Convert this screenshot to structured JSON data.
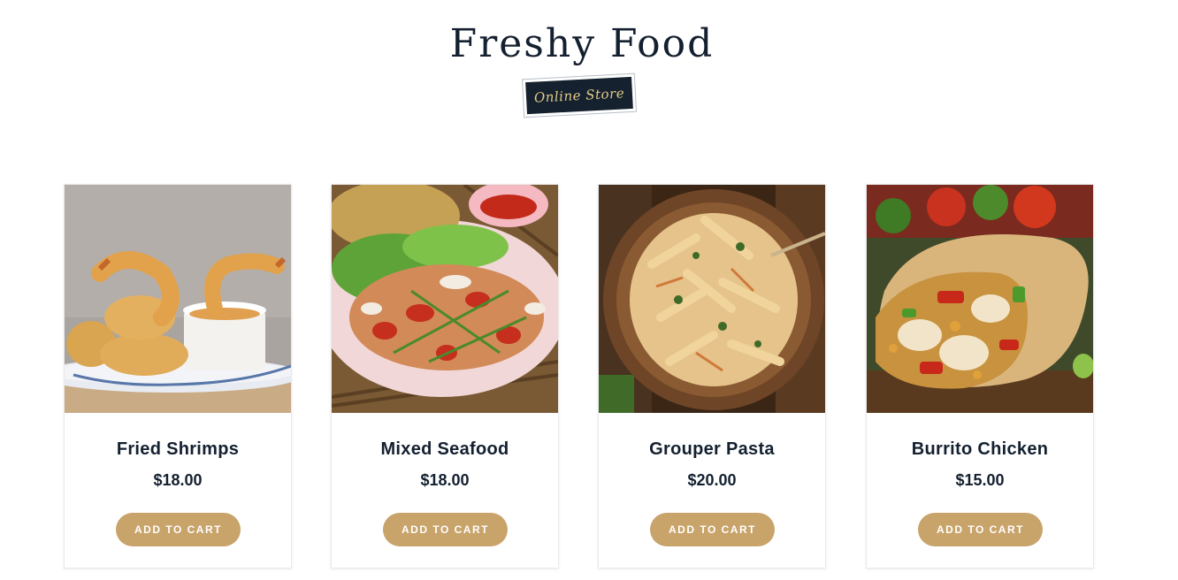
{
  "header": {
    "brand_title": "Freshy Food",
    "badge_label": "Online Store"
  },
  "products": [
    {
      "name": "Fried Shrimps",
      "price": "$18.00",
      "button_label": "ADD TO CART",
      "image": "fried-shrimps-photo"
    },
    {
      "name": "Mixed Seafood",
      "price": "$18.00",
      "button_label": "ADD TO CART",
      "image": "mixed-seafood-photo"
    },
    {
      "name": "Grouper Pasta",
      "price": "$20.00",
      "button_label": "ADD TO CART",
      "image": "grouper-pasta-photo"
    },
    {
      "name": "Burrito Chicken",
      "price": "$15.00",
      "button_label": "ADD TO CART",
      "image": "burrito-chicken-photo"
    }
  ],
  "colors": {
    "brand_dark": "#142030",
    "accent_gold": "#c8a36a",
    "badge_text": "#e2c989"
  }
}
